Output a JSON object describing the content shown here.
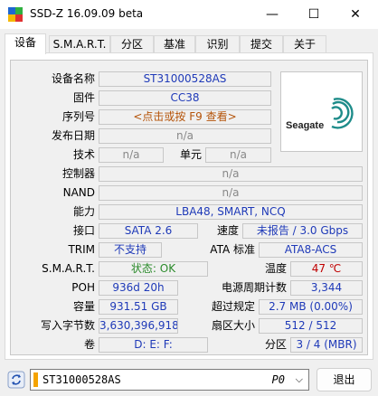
{
  "window": {
    "title": "SSD-Z 16.09.09 beta",
    "minimize": "—",
    "maximize": "☐",
    "close": "✕"
  },
  "tabs": [
    {
      "label": "设备"
    },
    {
      "label": "S.M.A.R.T."
    },
    {
      "label": "分区"
    },
    {
      "label": "基准"
    },
    {
      "label": "识别"
    },
    {
      "label": "提交"
    },
    {
      "label": "关于"
    }
  ],
  "device": {
    "model_label": "设备名称",
    "model": "ST31000528AS",
    "firmware_label": "固件",
    "firmware": "CC38",
    "serial_label": "序列号",
    "serial": "<点击或按 F9 查看>",
    "release_label": "发布日期",
    "release": "n/a",
    "tech_label": "技术",
    "tech": "n/a",
    "cell_label": "单元",
    "cell": "n/a",
    "controller_label": "控制器",
    "controller": "n/a",
    "nand_label": "NAND",
    "nand": "n/a",
    "capability_label": "能力",
    "capability": "LBA48, SMART, NCQ",
    "interface_label": "接口",
    "interface": "SATA 2.6",
    "speed_label": "速度",
    "speed": "未报告 / 3.0 Gbps",
    "trim_label": "TRIM",
    "trim": "不支持",
    "ata_label": "ATA 标准",
    "ata": "ATA8-ACS",
    "smart_label": "S.M.A.R.T.",
    "smart": "状态: OK",
    "temp_label": "温度",
    "temp": "47 ℃",
    "poh_label": "POH",
    "poh": "936d 20h",
    "cycles_label": "电源周期计数",
    "cycles": "3,344",
    "capacity_label": "容量",
    "capacity": "931.51 GB",
    "overprov_label": "超过规定",
    "overprov": "2.7 MB (0.00%)",
    "written_label": "写入字节数",
    "written": "3,630,396,918",
    "sector_label": "扇区大小",
    "sector": "512 / 512",
    "volume_label": "卷",
    "volume": "D:  E:  F:",
    "partition_label": "分区",
    "partition": "3 / 4 (MBR)"
  },
  "logo": {
    "brand": "Seagate"
  },
  "bottom": {
    "drive": "ST31000528AS",
    "port": "P0",
    "exit": "退出"
  },
  "colors": {
    "value_blue": "#1f3ab8",
    "value_grey": "#888888",
    "serial_orange": "#b45309",
    "ok_green": "#2a8a2a",
    "temp_red": "#c00000",
    "drive_marker": "#f5a300",
    "seagate_teal": "#1e8c8a"
  }
}
